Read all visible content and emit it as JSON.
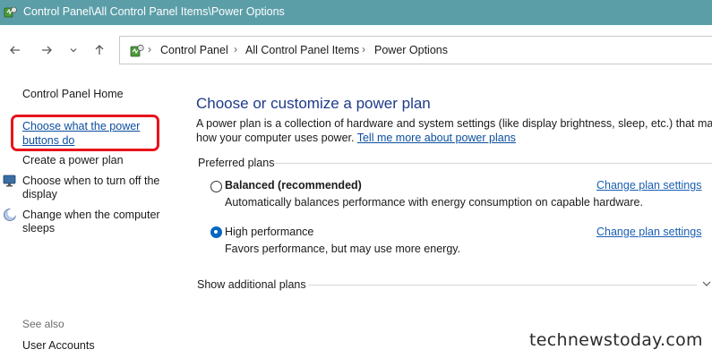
{
  "window": {
    "title": "Control Panel\\All Control Panel Items\\Power Options"
  },
  "navigation": {
    "breadcrumbs": [
      "Control Panel",
      "All Control Panel Items",
      "Power Options"
    ],
    "separator": "›"
  },
  "sidebar": {
    "home_label": "Control Panel Home",
    "links": [
      {
        "label_line1": "Choose what the power",
        "label_line2": "buttons do",
        "highlighted": true
      },
      {
        "label_line1": "Create a power plan"
      },
      {
        "label_line1": "Choose when to turn off the",
        "label_line2": "display",
        "icon": "display-icon"
      },
      {
        "label_line1": "Change when the computer",
        "label_line2": "sleeps",
        "icon": "moon-icon"
      }
    ],
    "see_also_label": "See also",
    "see_also_links": [
      "User Accounts"
    ]
  },
  "main": {
    "title": "Choose or customize a power plan",
    "description_line1": "A power plan is a collection of hardware and system settings (like display brightness, sleep, etc.) that manages",
    "description_line2": "how your computer uses power.",
    "learn_more_link": "Tell me more about power plans",
    "preferred_label": "Preferred plans",
    "plans": [
      {
        "name": "Balanced (recommended)",
        "description": "Automatically balances performance with energy consumption on capable hardware.",
        "selected": false,
        "settings_link": "Change plan settings"
      },
      {
        "name": "High performance",
        "description": "Favors performance, but may use more energy.",
        "selected": true,
        "settings_link": "Change plan settings"
      }
    ],
    "additional_plans_label": "Show additional plans"
  },
  "watermark": "technewstoday.com",
  "colors": {
    "titlebar": "#5b9ea8",
    "link": "#0b4e9e",
    "highlight": "#e8141b",
    "radio_selected": "#0067c0"
  }
}
